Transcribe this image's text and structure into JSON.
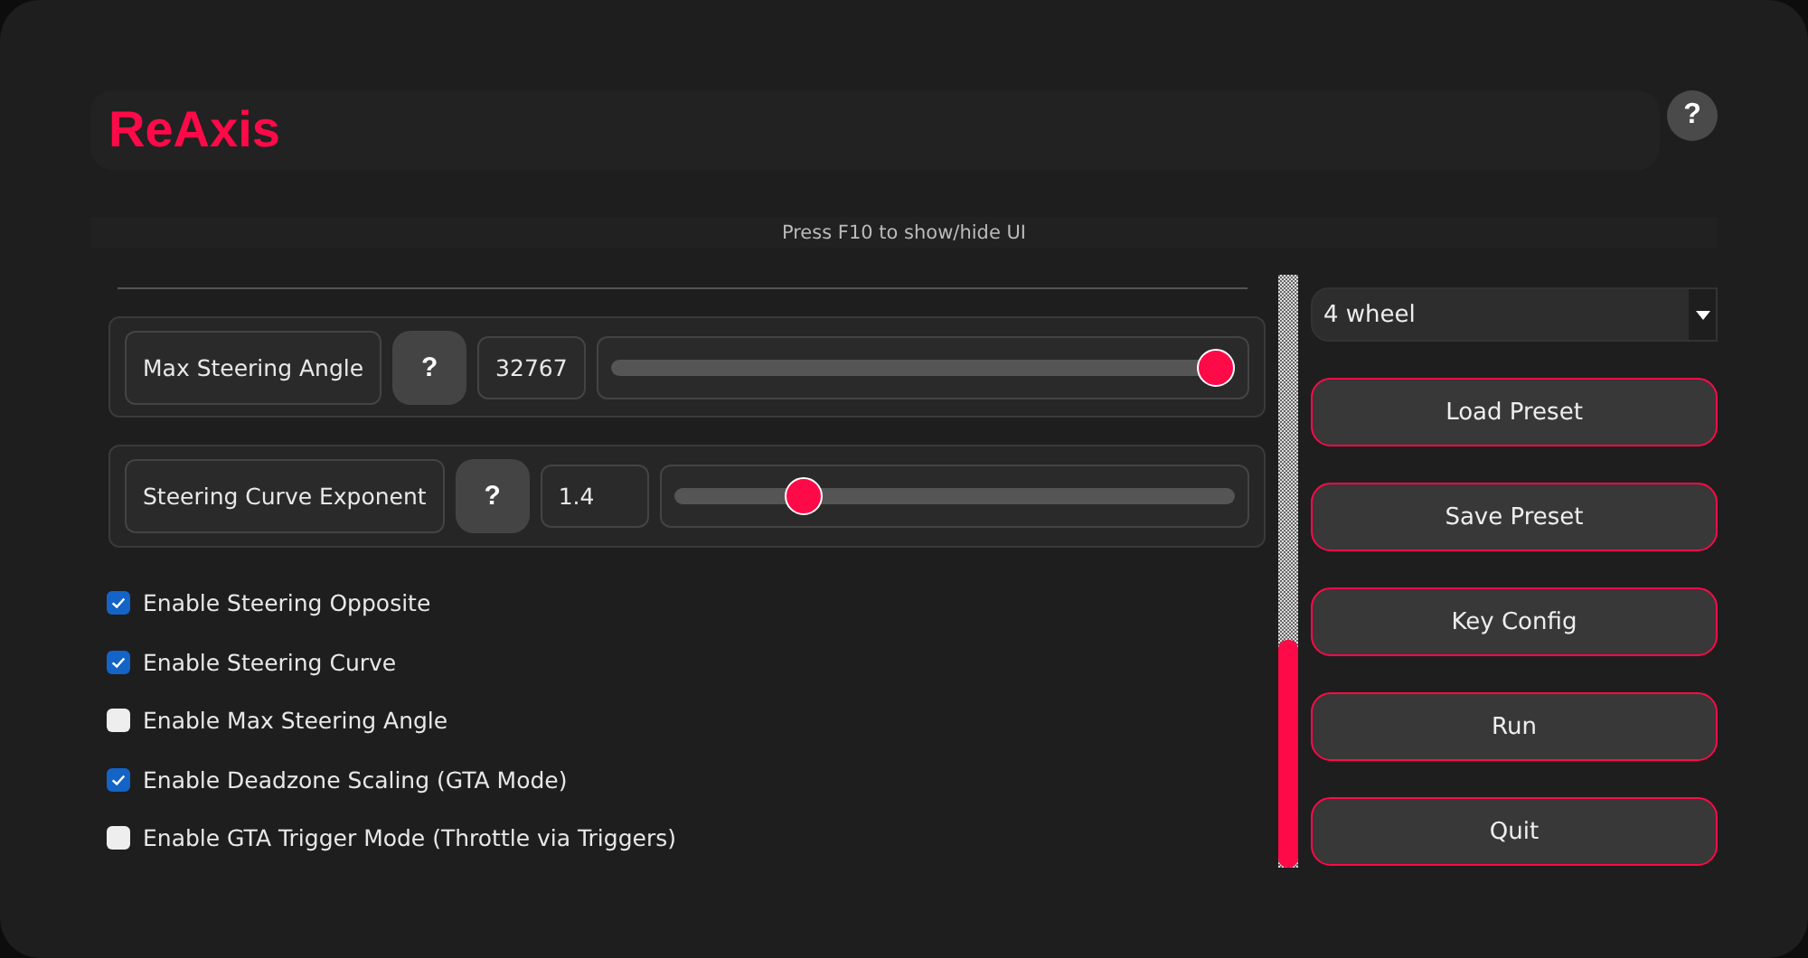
{
  "header": {
    "title": "ReAxis",
    "help_button": "?"
  },
  "hint": "Press F10 to show/hide UI",
  "sliders": [
    {
      "label": "Max Steering Angle",
      "help_button": "?",
      "value": "32767",
      "level": 1.0
    },
    {
      "label": "Steering Curve Exponent",
      "help_button": "?",
      "value": "1.4",
      "level": 0.21
    }
  ],
  "options": [
    {
      "label": "Enable Steering Opposite",
      "checked": true
    },
    {
      "label": "Enable Steering Curve",
      "checked": true
    },
    {
      "label": "Enable Max Steering Angle",
      "checked": false
    },
    {
      "label": "Enable Deadzone Scaling (GTA Mode)",
      "checked": true
    },
    {
      "label": "Enable GTA Trigger Mode (Throttle via Triggers)",
      "checked": false
    }
  ],
  "preset_dropdown": {
    "value": "4 wheel"
  },
  "buttons": [
    "Load Preset",
    "Save Preset",
    "Key Config",
    "Run",
    "Quit"
  ]
}
